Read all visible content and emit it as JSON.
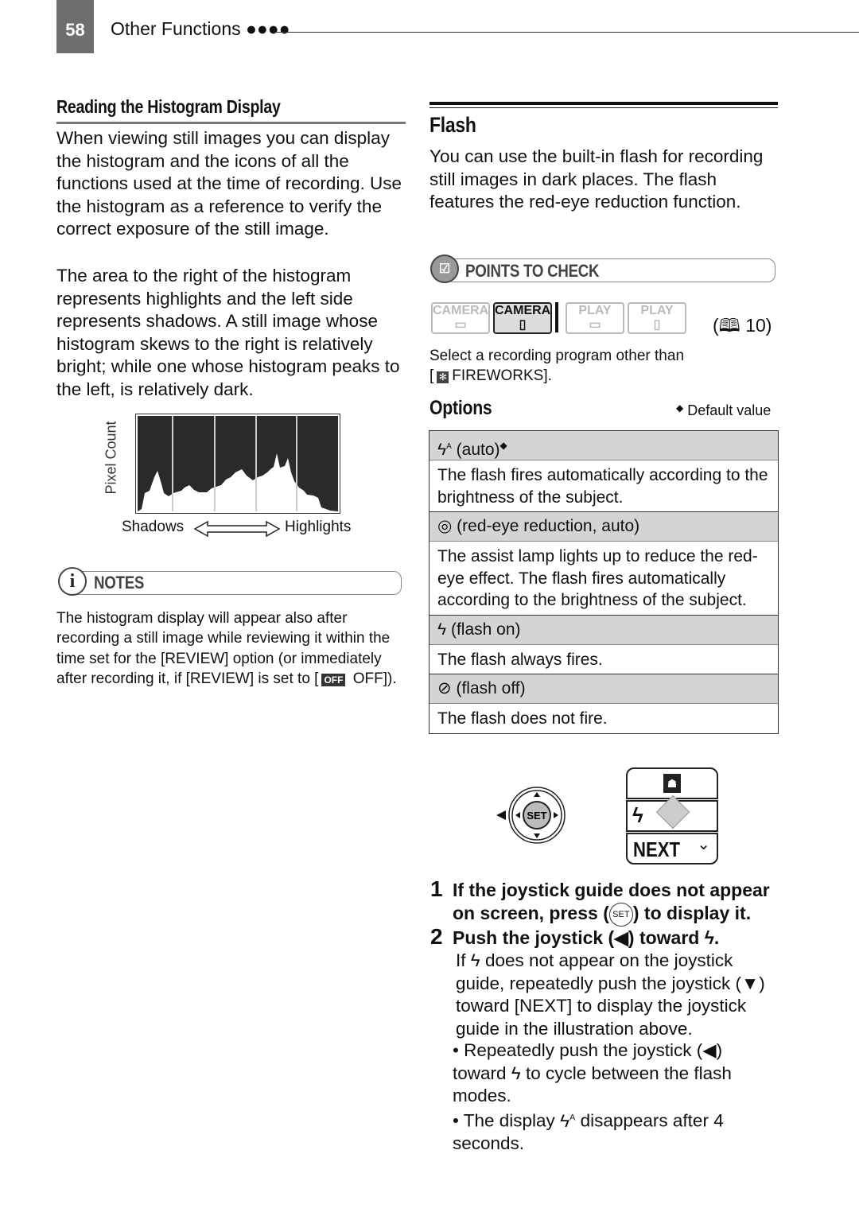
{
  "header": {
    "page_number": "58",
    "section": "Other Functions ●●●●"
  },
  "histogram_section": {
    "title": "Reading the Histogram Display",
    "para1": "When viewing still images you can display the histogram and the icons of all the functions used at the time of recording. Use the histogram as a reference to verify the correct exposure of the still image.",
    "para2": "The area to the right of the histogram represents highlights and the left side represents shadows. A still image whose histogram skews to the right is relatively bright; while one whose histogram peaks to the left, is relatively dark.",
    "figure": {
      "ylabel": "Pixel Count",
      "left_label": "Shadows",
      "right_label": "Highlights"
    }
  },
  "notes": {
    "title": "NOTES",
    "text_before": "The histogram display will appear also after recording a still image while reviewing it within the time set for the [REVIEW] option (or immediately after recording it, if [REVIEW] is set to [",
    "off_icon": "OFF",
    "text_after": " OFF])."
  },
  "flash": {
    "title": "Flash",
    "intro": "You can use the built-in flash for recording still images in dark places. The flash features the red-eye reduction function.",
    "points_title": "POINTS TO CHECK",
    "modes": [
      {
        "top": "CAMERA",
        "icon": "tape-icon",
        "active": false
      },
      {
        "top": "CAMERA",
        "icon": "card-icon",
        "active": true
      },
      {
        "top": "PLAY",
        "icon": "tape-icon",
        "active": false
      },
      {
        "top": "PLAY",
        "icon": "card-icon",
        "active": false
      }
    ],
    "page_ref": "10",
    "check_text": "Select a recording program other than",
    "check_text2": "FIREWORKS].",
    "options_title": "Options",
    "default_note": "Default value",
    "options": [
      {
        "label": "(auto)",
        "icon": "flash-auto-icon",
        "default": true,
        "desc": "The flash fires automatically according to the brightness of the subject."
      },
      {
        "label": "(red-eye reduction, auto)",
        "icon": "red-eye-icon",
        "desc": "The assist lamp lights up to reduce the red-eye effect. The flash fires automatically according to the brightness of the subject."
      },
      {
        "label": "(flash on)",
        "icon": "flash-on-icon",
        "desc": "The flash always fires."
      },
      {
        "label": "(flash off)",
        "icon": "flash-off-icon",
        "desc": "The flash does not fire."
      }
    ],
    "joystick": {
      "set_label": "SET",
      "next_label": "NEXT"
    },
    "steps": [
      {
        "num": "1",
        "text_a": "If the joystick guide does not appear on screen, press (",
        "text_b": ") to display it."
      },
      {
        "num": "2",
        "text_a": "Push the joystick (◀) toward",
        "text_b": "."
      }
    ],
    "step2_body": {
      "p1a": "If",
      "p1b": "does not appear on the joystick guide, repeatedly push the joystick (▼) toward [NEXT] to display the joystick guide in the illustration above.",
      "b1a": "Repeatedly push the joystick (◀) toward",
      "b1b": "to cycle between the flash modes.",
      "b2a": "The display",
      "b2b": "disappears after 4 seconds."
    }
  }
}
